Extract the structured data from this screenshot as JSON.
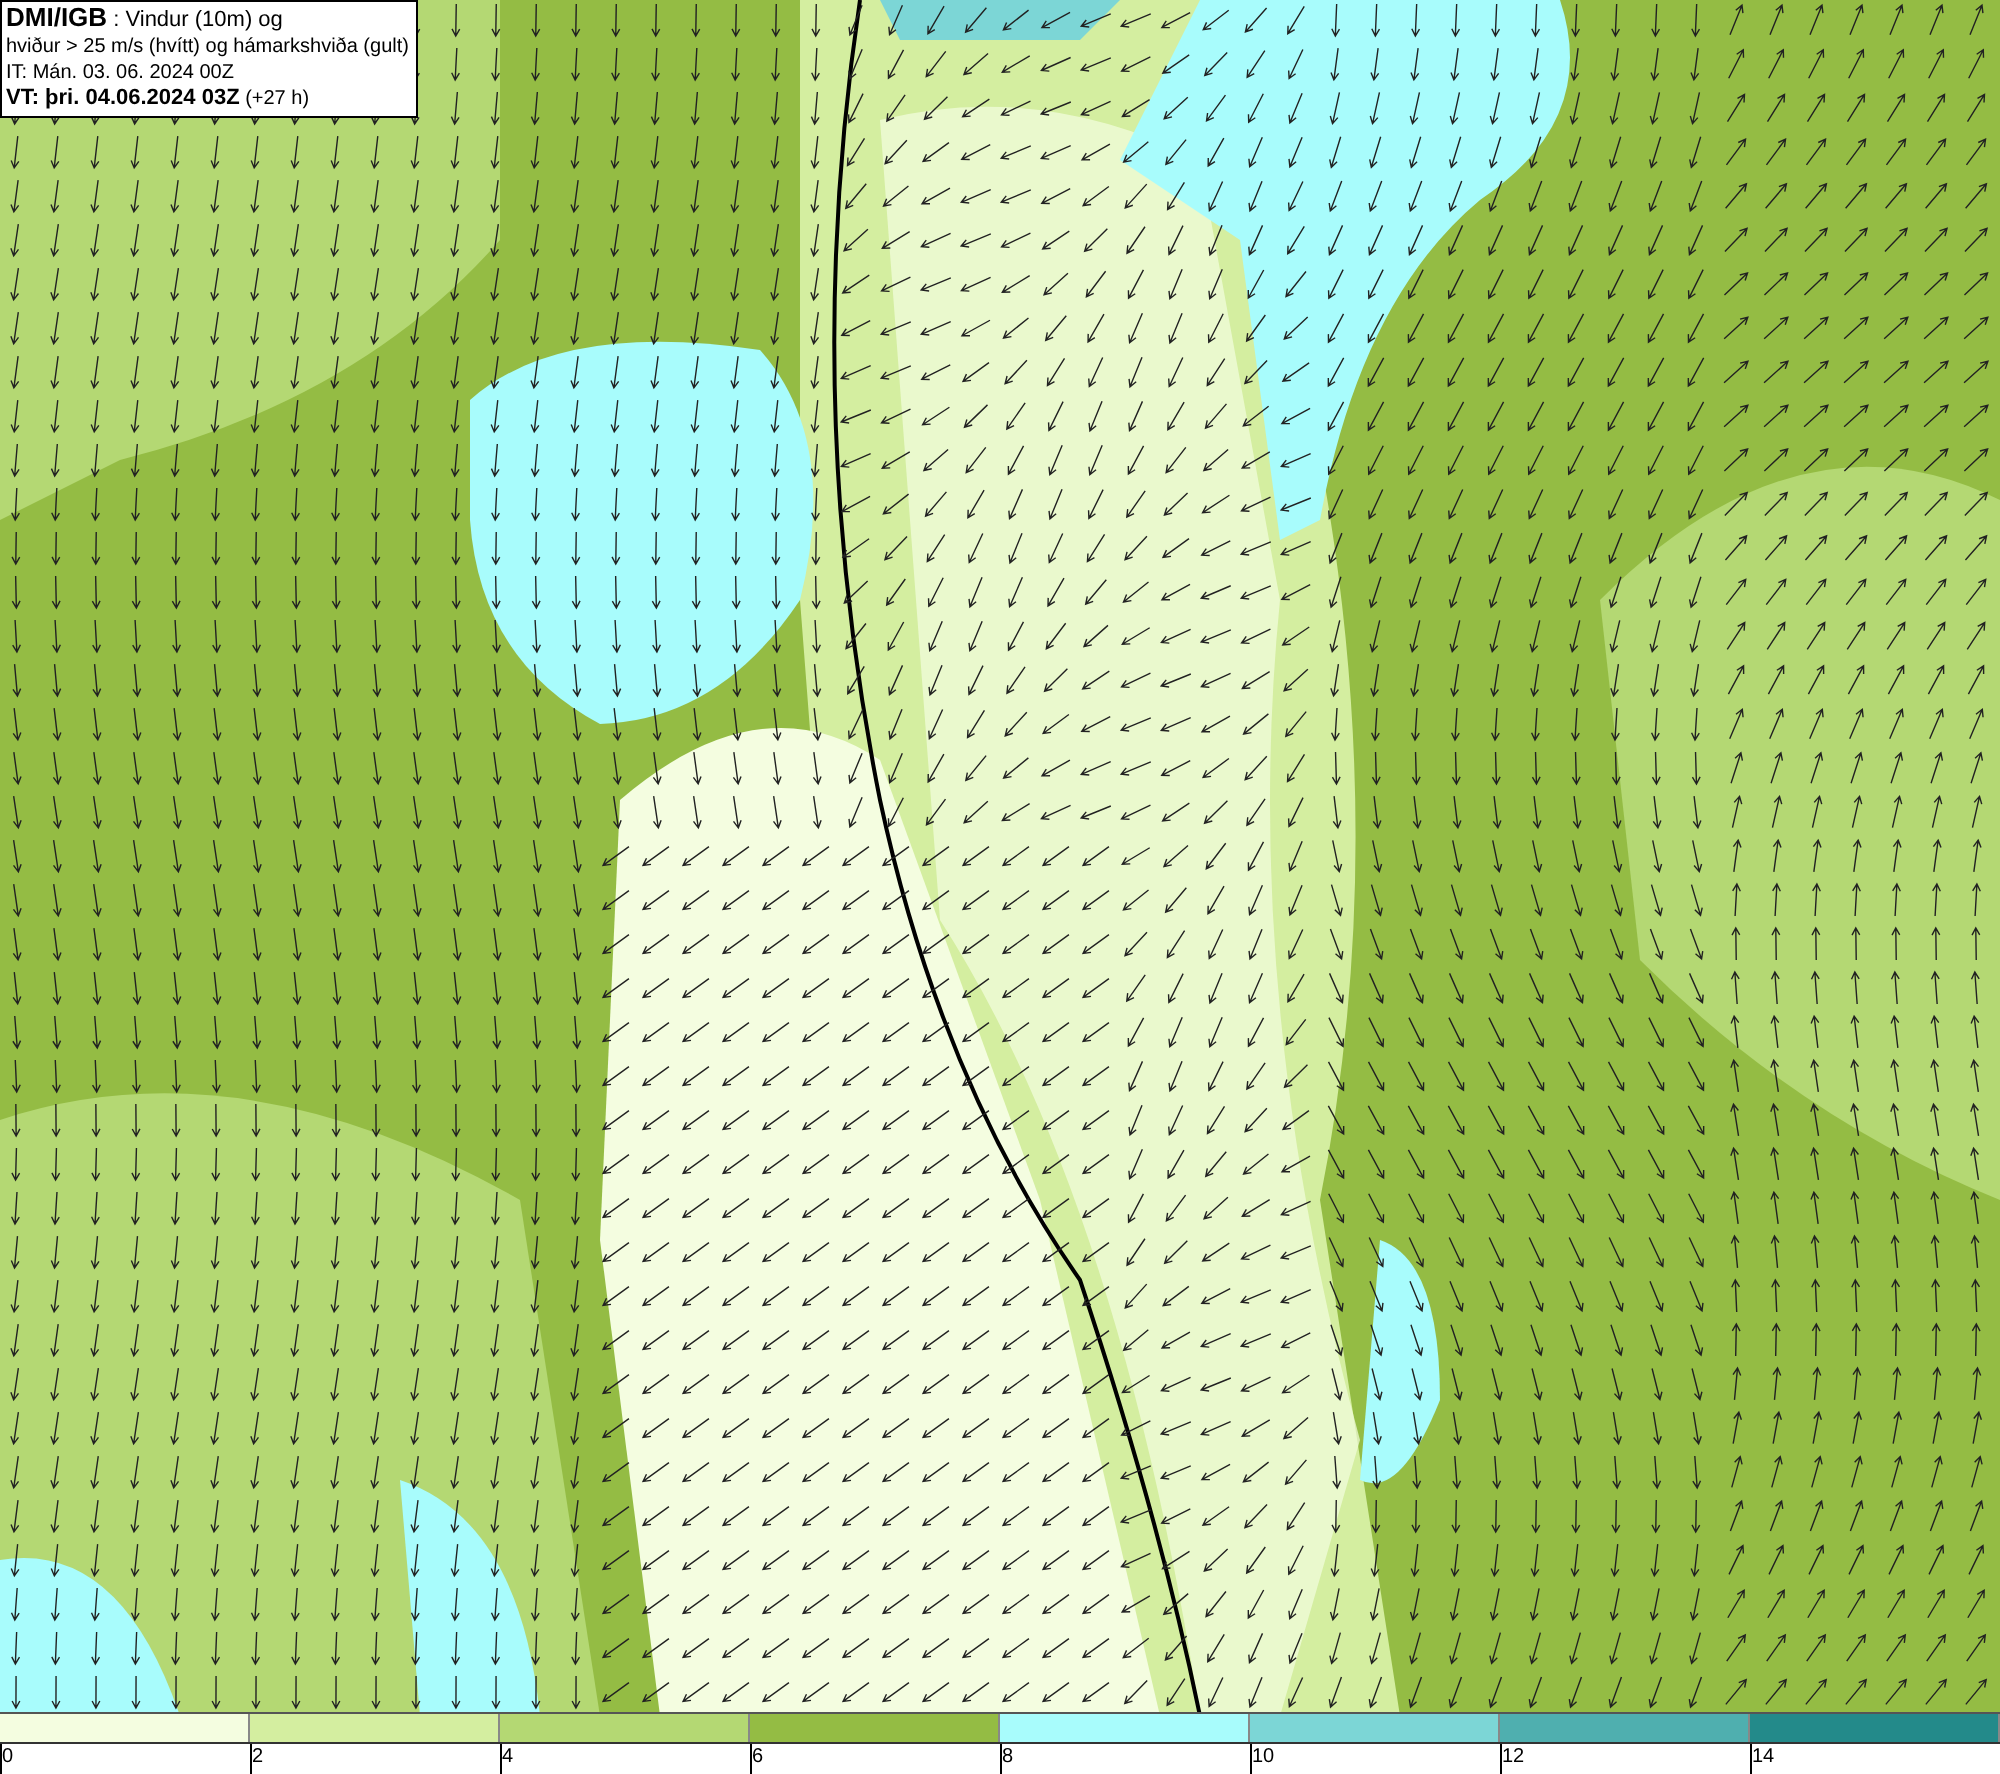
{
  "header": {
    "lines": [
      "**DMI/IGB** : Vindur (10m) og",
      "hviður > 25 m/s (hvítt) og hámarkshviða (gult)",
      "IT: Mán. 03. 06. 2024 00Z",
      "**VT: þri. 04.06.2024 03Z** (+27 h)"
    ]
  },
  "legend": {
    "bins": [
      {
        "label": "0",
        "color": "#f4fde0"
      },
      {
        "label": "2",
        "color": "#d4eea0"
      },
      {
        "label": "4",
        "color": "#b4d873"
      },
      {
        "label": "6",
        "color": "#94bc44"
      },
      {
        "label": "8",
        "color": "#a8fcfc"
      },
      {
        "label": "10",
        "color": "#7cd6d6"
      },
      {
        "label": "12",
        "color": "#4fafaf"
      },
      {
        "label": "14",
        "color": "#238a8a"
      }
    ]
  }
}
